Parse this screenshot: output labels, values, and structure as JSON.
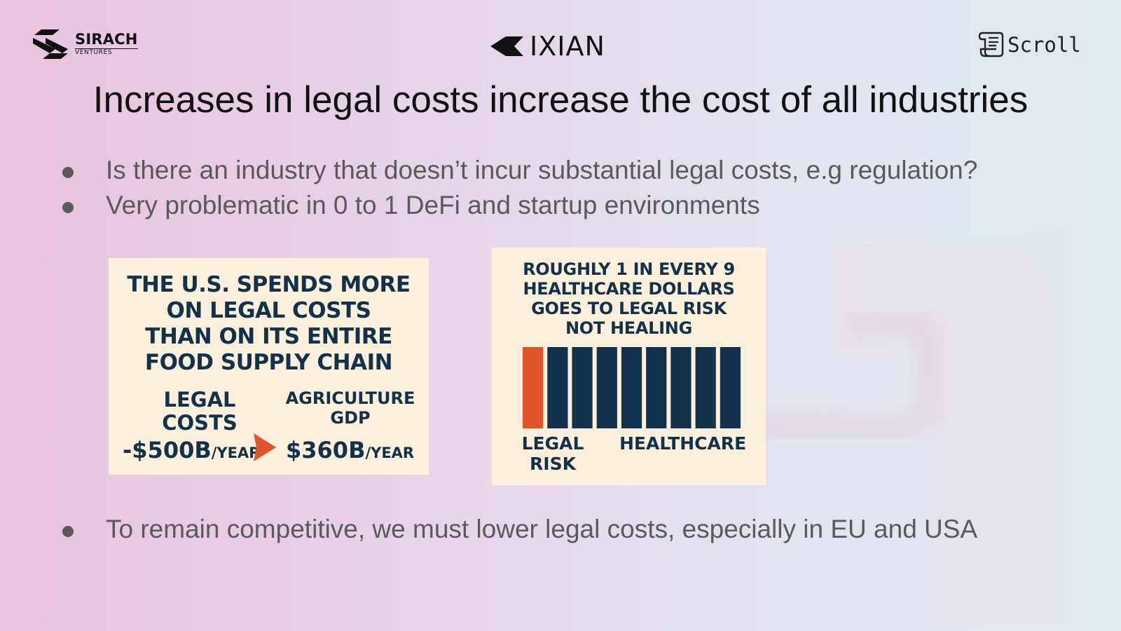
{
  "logos": {
    "sirach": {
      "name": "SIRACH",
      "sub": "VENTURES"
    },
    "ixian": {
      "name": "IXIAN"
    },
    "scroll": {
      "name": "Scroll"
    }
  },
  "title": "Increases in legal costs increase the cost of all industries",
  "bullets_top": [
    "Is there an industry that doesn’t incur substantial legal costs, e.g regulation?",
    "Very problematic in 0 to 1 DeFi and startup environments"
  ],
  "bullets_bottom": [
    "To remain competitive, we must lower legal costs, especially in EU and USA"
  ],
  "card_food": {
    "headline": [
      "THE U.S. SPENDS MORE",
      "ON LEGAL COSTS",
      "THAN ON ITS ENTIRE",
      "FOOD SUPPLY CHAIN"
    ],
    "legal_label": [
      "LEGAL",
      "COSTS"
    ],
    "legal_value": "-$500B",
    "legal_unit": "/YEAR",
    "agri_label": [
      "AGRICULTURE",
      "GDP"
    ],
    "agri_value": "$360B",
    "agri_unit": "/YEAR"
  },
  "card_health": {
    "headline": [
      "ROUGHLY 1 IN EVERY 9",
      "HEALTHCARE DOLLARS",
      "GOES TO LEGAL RISK",
      "NOT HEALING"
    ],
    "legal_label": [
      "LEGAL",
      "RISK"
    ],
    "healthcare_label": "HEALTHCARE",
    "bars": {
      "total": 9,
      "highlighted": 1
    }
  },
  "colors": {
    "navy": "#12324b",
    "accent": "#e0542a",
    "card_bg": "#fcefdc",
    "bullet_text": "#5a5a5a"
  }
}
